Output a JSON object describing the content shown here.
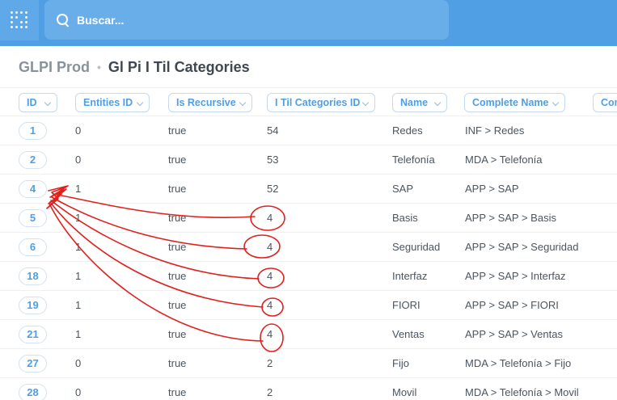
{
  "app": {
    "logo_icon": "metabase-logo-icon"
  },
  "search": {
    "placeholder": "Buscar..."
  },
  "breadcrumb": {
    "database": "GLPI Prod",
    "separator": "•",
    "table": "Gl Pi I Til Categories"
  },
  "table": {
    "columns": [
      "ID",
      "Entities ID",
      "Is Recursive",
      "I Til Categories ID",
      "Name",
      "Complete Name",
      "Com"
    ],
    "rows": [
      [
        "1",
        "0",
        "true",
        "54",
        "Redes",
        "INF > Redes"
      ],
      [
        "2",
        "0",
        "true",
        "53",
        "Telefonía",
        "MDA > Telefonía"
      ],
      [
        "4",
        "1",
        "true",
        "52",
        "SAP",
        "APP > SAP"
      ],
      [
        "5",
        "1",
        "true",
        "4",
        "Basis",
        "APP > SAP > Basis"
      ],
      [
        "6",
        "1",
        "true",
        "4",
        "Seguridad",
        "APP > SAP > Seguridad"
      ],
      [
        "18",
        "1",
        "true",
        "4",
        "Interfaz",
        "APP > SAP > Interfaz"
      ],
      [
        "19",
        "1",
        "true",
        "4",
        "FIORI",
        "APP > SAP > FIORI"
      ],
      [
        "21",
        "1",
        "true",
        "4",
        "Ventas",
        "APP > SAP > Ventas"
      ],
      [
        "27",
        "0",
        "true",
        "2",
        "Fijo",
        "MDA > Telefonía > Fijo"
      ],
      [
        "28",
        "0",
        "true",
        "2",
        "Movil",
        "MDA > Telefonía > Movil"
      ]
    ]
  },
  "annotation": {
    "color": "#e0201c"
  }
}
